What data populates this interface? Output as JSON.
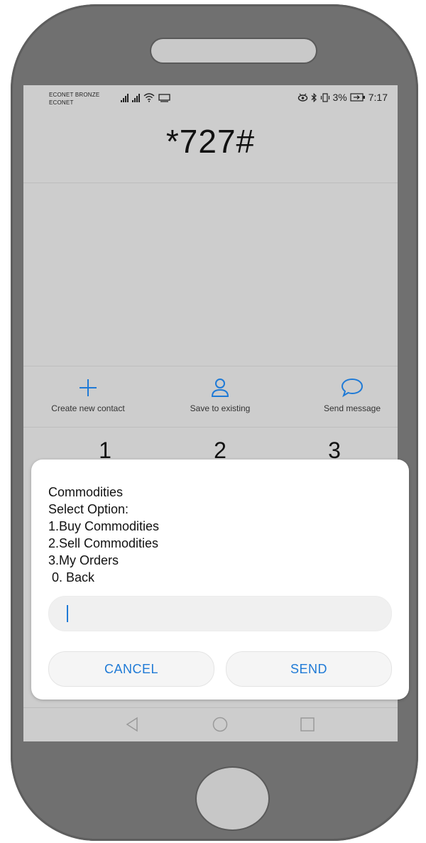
{
  "status_bar": {
    "carrier_1": "ECONET BRONZE",
    "carrier_2": "ECONET",
    "battery": "3%",
    "time": "7:17"
  },
  "dialer": {
    "number": "*727#"
  },
  "actions": {
    "create_contact": "Create new contact",
    "save_existing": "Save to existing",
    "send_message": "Send message"
  },
  "keypad": {
    "keys": [
      "1",
      "2",
      "3"
    ]
  },
  "ussd_dialog": {
    "message": "Commodities\nSelect Option:\n1.Buy Commodities\n2.Sell Commodities\n3.My Orders\n 0. Back",
    "input_value": "",
    "cancel_label": "CANCEL",
    "send_label": "SEND"
  },
  "colors": {
    "accent": "#1f7ad6",
    "phone_body": "#707070",
    "screen_bg": "#cdcdcd"
  },
  "icons": {
    "add": "plus-icon",
    "contact": "person-icon",
    "message": "chat-bubble-icon"
  }
}
